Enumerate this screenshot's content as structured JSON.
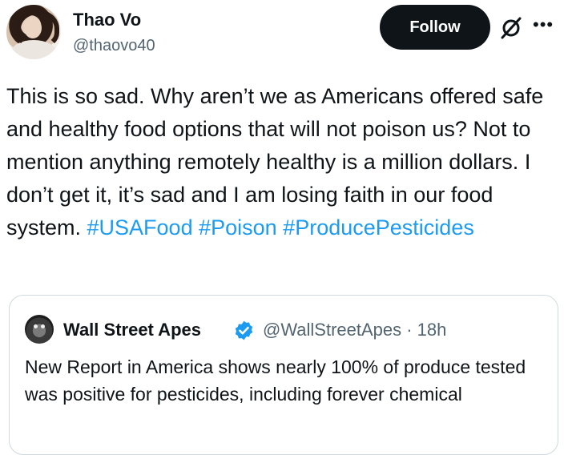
{
  "author": {
    "name": "Thao Vo",
    "handle": "@thaovo40",
    "follow_label": "Follow",
    "more_label": "•••"
  },
  "tweet": {
    "text": "This is so sad. Why aren’t we as Americans offered safe and healthy food options that will not poison us? Not to mention anything remotely healthy is a million dollars. I don’t get it, it’s sad and I am losing faith in our food system. ",
    "hashtags": [
      "#USAFood",
      "#Poison",
      "#ProducePesticides"
    ]
  },
  "quoted": {
    "name": "Wall Street Apes",
    "handle_time": "@WallStreetApes · 18h",
    "text": "New Report in America shows nearly 100% of produce tested was positive for pesticides, including forever chemical",
    "verified_color": "#1d9bf0"
  },
  "colors": {
    "accent": "#1d9bf0",
    "text": "#0f1419",
    "muted": "#536471",
    "border": "#cfd9de"
  }
}
